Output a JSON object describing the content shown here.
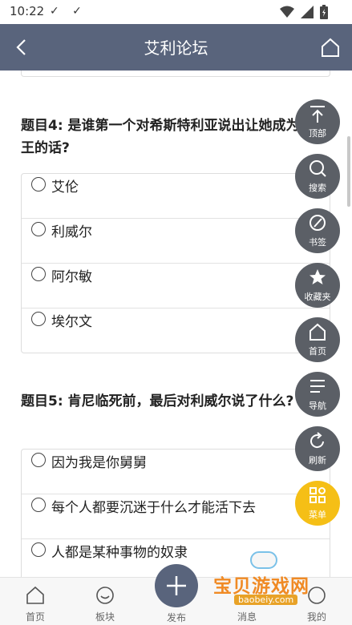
{
  "status": {
    "time": "10:22",
    "checks": "✓ ✓"
  },
  "header": {
    "title": "艾利论坛"
  },
  "questions": [
    {
      "title": "题目4: 是谁第一个对希斯特利亚说出让她成为女王的话?",
      "options": [
        "艾伦",
        "利威尔",
        "阿尔敏",
        "埃尔文"
      ]
    },
    {
      "title": "题目5: 肯尼临死前，最后对利威尔说了什么?",
      "options": [
        "因为我是你舅舅",
        "每个人都要沉迷于什么才能活下去",
        "人都是某种事物的奴隶"
      ]
    }
  ],
  "fab": {
    "top": "顶部",
    "search": "搜索",
    "bookmark": "书签",
    "favorites": "收藏夹",
    "home": "首页",
    "nav": "导航",
    "refresh": "刷新",
    "menu": "菜单"
  },
  "tabbar": {
    "home": "首页",
    "boards": "板块",
    "publish": "发布",
    "messages": "消息",
    "mine": "我的"
  },
  "watermark": {
    "title": "宝贝游戏网",
    "url": "baobeiy.com"
  },
  "colors": {
    "navbar": "#59647c",
    "fab": "#5b5f66",
    "fab_menu": "#f5bf16"
  }
}
